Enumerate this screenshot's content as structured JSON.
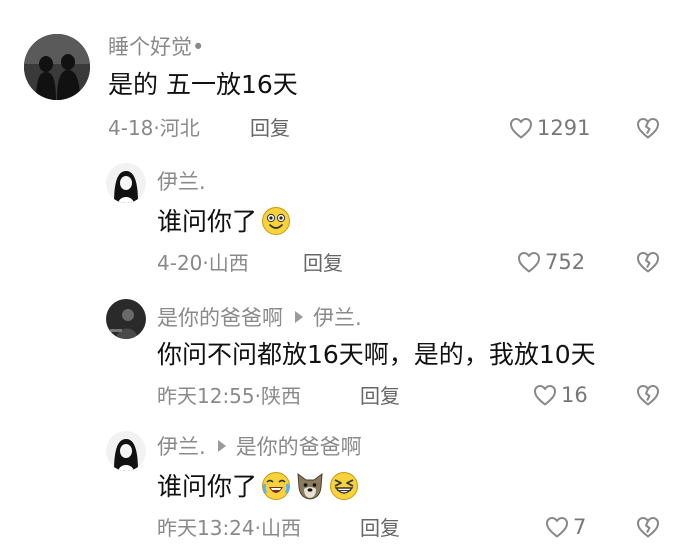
{
  "comments": [
    {
      "username": "睡个好觉•",
      "text": "是的 五一放16天",
      "meta": "4-18·河北",
      "reply_label": "回复",
      "likes": "1291"
    },
    {
      "username": "伊兰.",
      "text": "谁问你了",
      "meta": "4-20·山西",
      "reply_label": "回复",
      "likes": "752",
      "emojis": [
        "grinning-face-icon"
      ]
    },
    {
      "username": "是你的爸爸啊",
      "reply_to": "伊兰.",
      "text": "你问不问都放16天啊，是的，我放10天",
      "meta": "昨天12:55·陕西",
      "reply_label": "回复",
      "likes": "16"
    },
    {
      "username": "伊兰.",
      "reply_to": "是你的爸爸啊",
      "text": "谁问你了",
      "meta": "昨天13:24·山西",
      "reply_label": "回复",
      "likes": "7",
      "emojis": [
        "crying-laugh-icon",
        "dog-face-icon",
        "squinting-laugh-icon"
      ]
    }
  ],
  "colors": {
    "text": "#111111",
    "meta": "#8a8a8a",
    "icon": "#777777"
  }
}
